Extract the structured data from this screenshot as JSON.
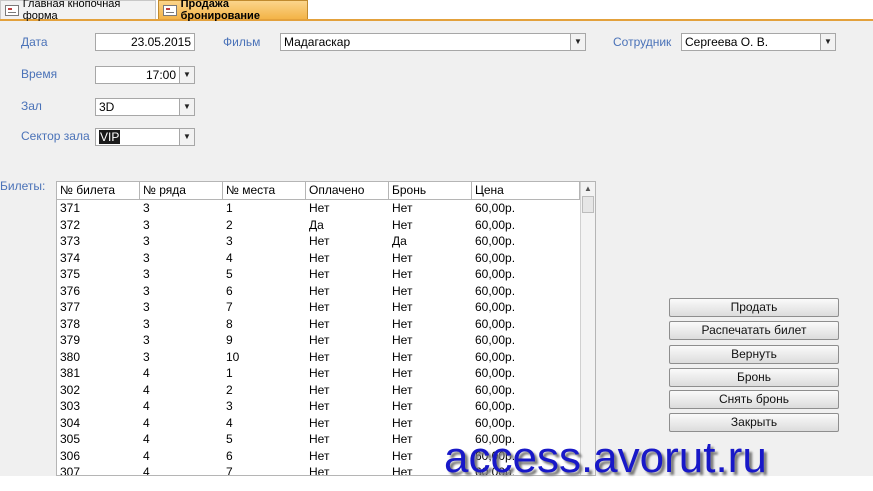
{
  "tabs": [
    {
      "label": "Главная кнопочная форма"
    },
    {
      "label": "Продажа бронирование"
    }
  ],
  "form": {
    "date": {
      "label": "Дата",
      "value": "23.05.2015"
    },
    "time": {
      "label": "Время",
      "value": "17:00"
    },
    "hall": {
      "label": "Зал",
      "value": "3D"
    },
    "sector": {
      "label": "Сектор зала",
      "value": "VIP"
    },
    "film": {
      "label": "Фильм",
      "value": "Мадагаскар"
    },
    "employee": {
      "label": "Сотрудник",
      "value": "Сергеева О. В."
    },
    "tickets_label": "Билеты:"
  },
  "table": {
    "columns": [
      "№ билета",
      "№ ряда",
      "№ места",
      "Оплачено",
      "Бронь",
      "Цена"
    ],
    "rows": [
      [
        "371",
        "3",
        "1",
        "Нет",
        "Нет",
        "60,00р."
      ],
      [
        "372",
        "3",
        "2",
        "Да",
        "Нет",
        "60,00р."
      ],
      [
        "373",
        "3",
        "3",
        "Нет",
        "Да",
        "60,00р."
      ],
      [
        "374",
        "3",
        "4",
        "Нет",
        "Нет",
        "60,00р."
      ],
      [
        "375",
        "3",
        "5",
        "Нет",
        "Нет",
        "60,00р."
      ],
      [
        "376",
        "3",
        "6",
        "Нет",
        "Нет",
        "60,00р."
      ],
      [
        "377",
        "3",
        "7",
        "Нет",
        "Нет",
        "60,00р."
      ],
      [
        "378",
        "3",
        "8",
        "Нет",
        "Нет",
        "60,00р."
      ],
      [
        "379",
        "3",
        "9",
        "Нет",
        "Нет",
        "60,00р."
      ],
      [
        "380",
        "3",
        "10",
        "Нет",
        "Нет",
        "60,00р."
      ],
      [
        "381",
        "4",
        "1",
        "Нет",
        "Нет",
        "60,00р."
      ],
      [
        "302",
        "4",
        "2",
        "Нет",
        "Нет",
        "60,00р."
      ],
      [
        "303",
        "4",
        "3",
        "Нет",
        "Нет",
        "60,00р."
      ],
      [
        "304",
        "4",
        "4",
        "Нет",
        "Нет",
        "60,00р."
      ],
      [
        "305",
        "4",
        "5",
        "Нет",
        "Нет",
        "60,00р."
      ],
      [
        "306",
        "4",
        "6",
        "Нет",
        "Нет",
        "60,00р."
      ],
      [
        "307",
        "4",
        "7",
        "Нет",
        "Нет",
        "60,00р."
      ]
    ]
  },
  "buttons": {
    "sell": "Продать",
    "print": "Распечатать билет",
    "return": "Вернуть",
    "book": "Бронь",
    "unbook": "Снять бронь",
    "close": "Закрыть"
  },
  "watermark": "access.avorut.ru",
  "colors": {
    "label": "#4a72b8",
    "active_tab": "#f3b347",
    "watermark": "#1818c8"
  }
}
